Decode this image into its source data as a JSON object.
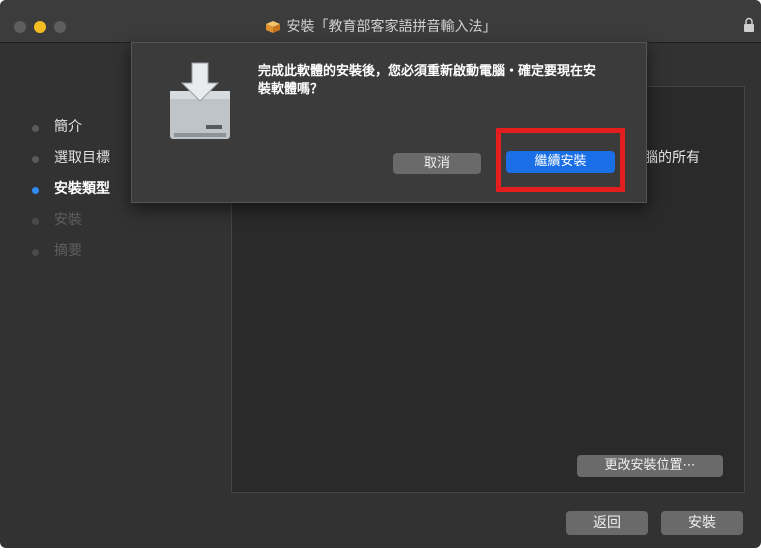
{
  "window": {
    "title": "安裝「教育部客家語拼音輸入法」",
    "icons": {
      "title_icon": "package-icon",
      "lock": "lock-icon"
    },
    "colors": {
      "minimize_dot": "#f5bd22",
      "accent": "#1b6fe6",
      "highlight": "#e41e1e",
      "current_step_dot": "#2f8cf5"
    }
  },
  "sidebar": {
    "steps": [
      {
        "label": "簡介",
        "state": "done"
      },
      {
        "label": "選取目標",
        "state": "done"
      },
      {
        "label": "安裝類型",
        "state": "current"
      },
      {
        "label": "安裝",
        "state": "pending"
      },
      {
        "label": "摘要",
        "state": "pending"
      }
    ]
  },
  "main": {
    "partial_text": "腦的所有",
    "change_location_label": "更改安裝位置⋯"
  },
  "footer": {
    "back_label": "返回",
    "install_label": "安裝"
  },
  "dialog": {
    "icon": "installer-disk-icon",
    "message": "完成此軟體的安裝後，您必須重新啟動電腦・確定要現在安裝軟體嗎？",
    "cancel_label": "取消",
    "continue_label": "繼續安裝"
  }
}
